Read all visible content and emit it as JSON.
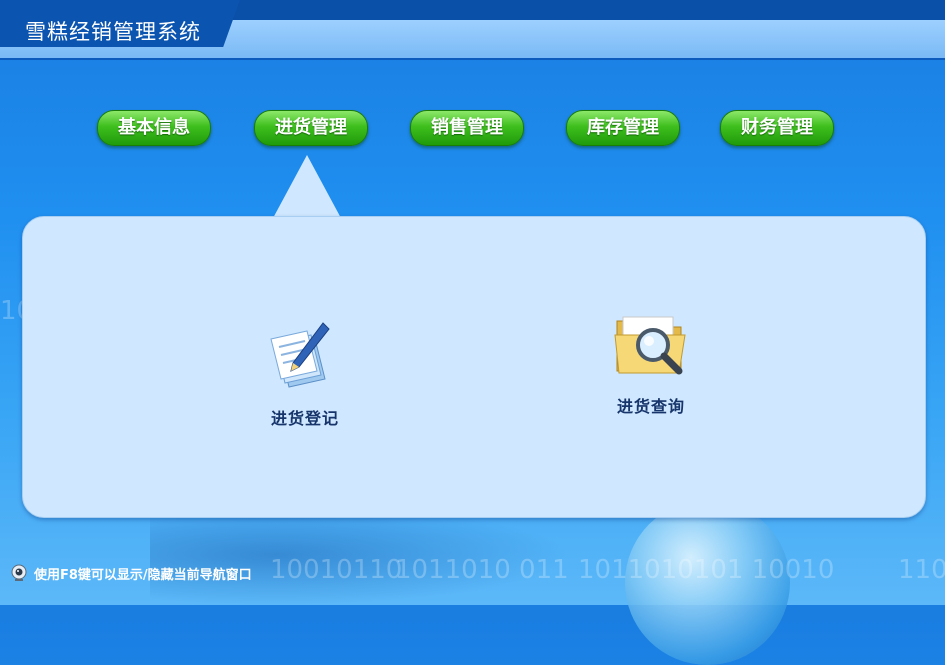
{
  "app": {
    "title": "雪糕经销管理系统"
  },
  "nav": {
    "items": [
      {
        "label": "基本信息"
      },
      {
        "label": "进货管理"
      },
      {
        "label": "销售管理"
      },
      {
        "label": "库存管理"
      },
      {
        "label": "财务管理"
      }
    ],
    "active": "进货管理"
  },
  "panel": {
    "tiles": [
      {
        "label": "进货登记",
        "icon": "notes-pen-icon"
      },
      {
        "label": "进货查询",
        "icon": "folder-search-icon"
      }
    ]
  },
  "status": {
    "text": "使用F8键可以显示/隐藏当前导航窗口",
    "icon": "webcam-icon"
  },
  "colors": {
    "accent_green": "#3fbf1e",
    "panel_bg": "#cfe8ff",
    "title_bar": "#0b54b0"
  }
}
